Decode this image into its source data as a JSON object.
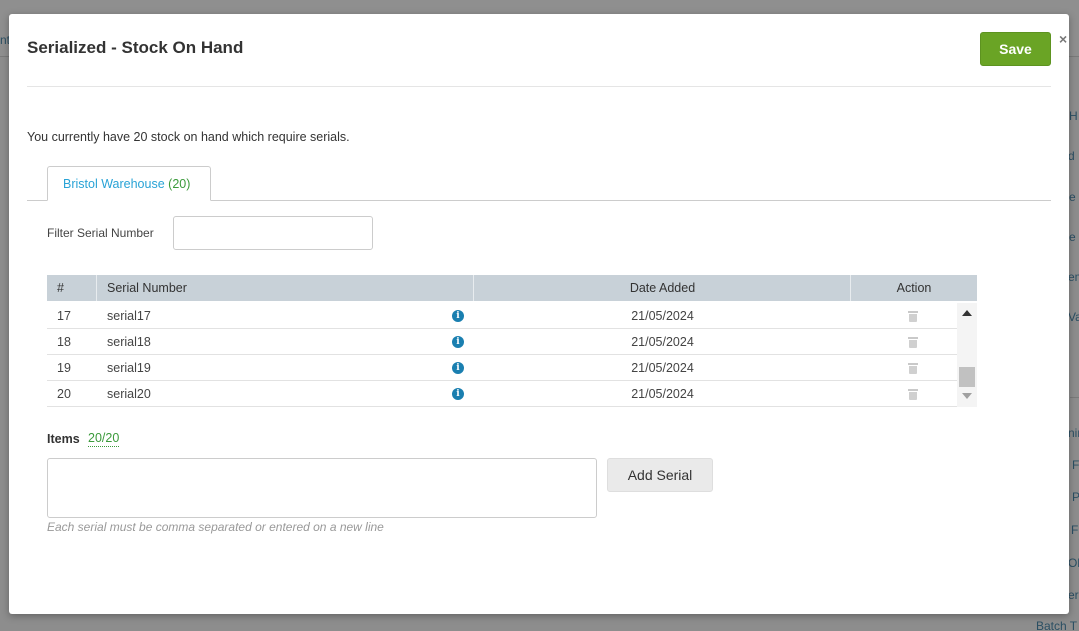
{
  "background": {
    "topbar_fragment": "nt",
    "right_fragments": [
      "H",
      "d",
      "e",
      "e",
      "em",
      "Va",
      "nir",
      "F",
      "P",
      "F",
      "Ob",
      "er",
      "Batch T"
    ]
  },
  "modal": {
    "title": "Serialized - Stock On Hand",
    "close_symbol": "×",
    "save_label": "Save",
    "stock_message": "You currently have 20 stock on hand which require serials.",
    "tab": {
      "name": "Bristol Warehouse",
      "count": "(20)"
    },
    "filter": {
      "label": "Filter Serial Number",
      "value": "",
      "placeholder": ""
    },
    "table": {
      "headers": [
        "#",
        "Serial Number",
        "Date Added",
        "Action"
      ],
      "rows": [
        {
          "num": "17",
          "serial": "serial17",
          "date": "21/05/2024"
        },
        {
          "num": "18",
          "serial": "serial18",
          "date": "21/05/2024"
        },
        {
          "num": "19",
          "serial": "serial19",
          "date": "21/05/2024"
        },
        {
          "num": "20",
          "serial": "serial20",
          "date": "21/05/2024"
        }
      ],
      "info_glyph": "i"
    },
    "items": {
      "label": "Items",
      "count": "20/20"
    },
    "serial_input": {
      "value": "",
      "placeholder": ""
    },
    "add_serial_label": "Add Serial",
    "help_text": "Each serial must be comma separated or entered on a new line"
  },
  "colors": {
    "save_green": "#6aa425",
    "tab_blue": "#29a3d6",
    "count_green": "#3b9a3b",
    "info_blue": "#1a7fb0",
    "table_header": "#c8d1d8"
  }
}
